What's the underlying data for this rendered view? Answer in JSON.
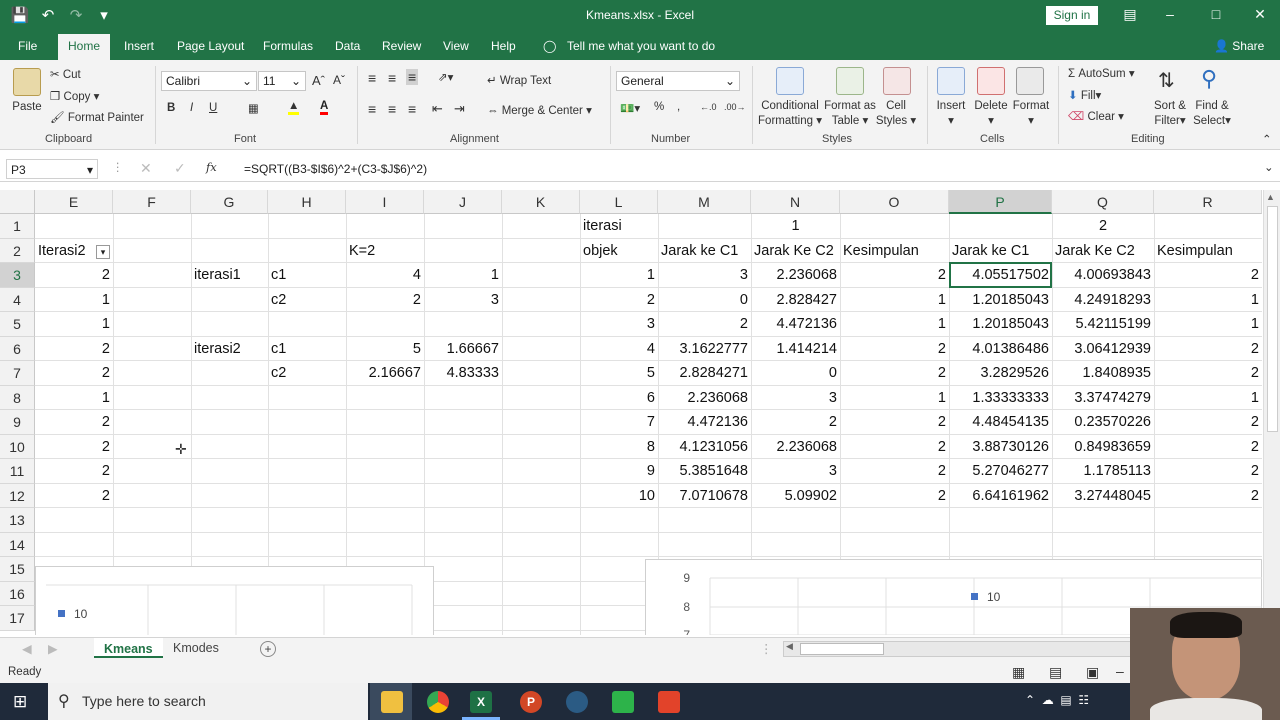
{
  "window": {
    "title": "Kmeans.xlsx  -  Excel",
    "signin": "Sign in",
    "share": "Share"
  },
  "menu_tabs": [
    "File",
    "Home",
    "Insert",
    "Page Layout",
    "Formulas",
    "Data",
    "Review",
    "View",
    "Help"
  ],
  "tell_me": "Tell me what you want to do",
  "ribbon": {
    "clipboard": {
      "paste": "Paste",
      "cut": "Cut",
      "copy": "Copy",
      "format_painter": "Format Painter",
      "group": "Clipboard"
    },
    "font": {
      "name": "Calibri",
      "size": "11",
      "bold": "B",
      "italic": "I",
      "underline": "U",
      "group": "Font"
    },
    "alignment": {
      "wrap_text": "Wrap Text",
      "merge_center": "Merge & Center",
      "group": "Alignment"
    },
    "number": {
      "format": "General",
      "percent": "%",
      "comma": ",",
      "group": "Number"
    },
    "styles": {
      "conditional": "Conditional",
      "conditional2": "Formatting",
      "format_as": "Format as",
      "format_as2": "Table",
      "cell": "Cell",
      "cell2": "Styles",
      "group": "Styles"
    },
    "cells": {
      "insert": "Insert",
      "delete": "Delete",
      "format": "Format",
      "group": "Cells"
    },
    "editing": {
      "autosum": "AutoSum",
      "fill": "Fill",
      "clear": "Clear",
      "sort": "Sort &",
      "sort2": "Filter",
      "find": "Find &",
      "find2": "Select",
      "group": "Editing"
    }
  },
  "formula_bar": {
    "name_box": "P3",
    "fx": "fx",
    "formula": "=SQRT((B3-$I$6)^2+(C3-$J$6)^2)"
  },
  "columns": [
    "E",
    "F",
    "G",
    "H",
    "I",
    "J",
    "K",
    "L",
    "M",
    "N",
    "O",
    "P",
    "Q",
    "R"
  ],
  "rows": [
    "1",
    "2",
    "3",
    "4",
    "5",
    "6",
    "7",
    "8",
    "9",
    "10",
    "11",
    "12",
    "13",
    "14",
    "15",
    "16",
    "17"
  ],
  "cells": {
    "L1": "iterasi",
    "N1": "1",
    "Q1": "2",
    "E2": "Iterasi2",
    "I2": "K=2",
    "L2": "objek",
    "M2": "Jarak ke C1",
    "N2": "Jarak Ke C2",
    "O2": "Kesimpulan",
    "P2": "Jarak ke C1",
    "Q2": "Jarak Ke C2",
    "R2": "Kesimpulan",
    "G3": "iterasi1",
    "H3": "c1",
    "I3": "4",
    "J3": "1",
    "H4": "c2",
    "I4": "2",
    "J4": "3",
    "G6": "iterasi2",
    "H6": "c1",
    "I6": "5",
    "J6": "1.66667",
    "H7": "c2",
    "I7": "2.16667",
    "J7": "4.83333"
  },
  "iterasi2_col": [
    "2",
    "1",
    "1",
    "2",
    "2",
    "1",
    "2",
    "2",
    "2",
    "2"
  ],
  "table": [
    {
      "objek": "1",
      "m": "3",
      "n": "2.236068",
      "o": "2",
      "p": "4.05517502",
      "q": "4.00693843",
      "r": "2"
    },
    {
      "objek": "2",
      "m": "0",
      "n": "2.828427",
      "o": "1",
      "p": "1.20185043",
      "q": "4.24918293",
      "r": "1"
    },
    {
      "objek": "3",
      "m": "2",
      "n": "4.472136",
      "o": "1",
      "p": "1.20185043",
      "q": "5.42115199",
      "r": "1"
    },
    {
      "objek": "4",
      "m": "3.1622777",
      "n": "1.414214",
      "o": "2",
      "p": "4.01386486",
      "q": "3.06412939",
      "r": "2"
    },
    {
      "objek": "5",
      "m": "2.8284271",
      "n": "0",
      "o": "2",
      "p": "3.2829526",
      "q": "1.8408935",
      "r": "2"
    },
    {
      "objek": "6",
      "m": "2.236068",
      "n": "3",
      "o": "1",
      "p": "1.33333333",
      "q": "3.37474279",
      "r": "1"
    },
    {
      "objek": "7",
      "m": "4.472136",
      "n": "2",
      "o": "2",
      "p": "4.48454135",
      "q": "0.23570226",
      "r": "2"
    },
    {
      "objek": "8",
      "m": "4.1231056",
      "n": "2.236068",
      "o": "2",
      "p": "3.88730126",
      "q": "0.84983659",
      "r": "2"
    },
    {
      "objek": "9",
      "m": "5.3851648",
      "n": "3",
      "o": "2",
      "p": "5.27046277",
      "q": "1.1785113",
      "r": "2"
    },
    {
      "objek": "10",
      "m": "7.0710678",
      "n": "5.09902",
      "o": "2",
      "p": "6.64161962",
      "q": "3.27448045",
      "r": "2"
    }
  ],
  "charts": {
    "left": {
      "point_label": "10"
    },
    "right": {
      "ticks": [
        "9",
        "8",
        "7"
      ],
      "point_label": "10"
    }
  },
  "sheets": [
    "Kmeans",
    "Kmodes"
  ],
  "active_sheet": "Kmeans",
  "status": "Ready",
  "taskbar": {
    "search_placeholder": "Type here to search"
  },
  "colors": {
    "accent": "#217346",
    "series": "#4472c4"
  }
}
